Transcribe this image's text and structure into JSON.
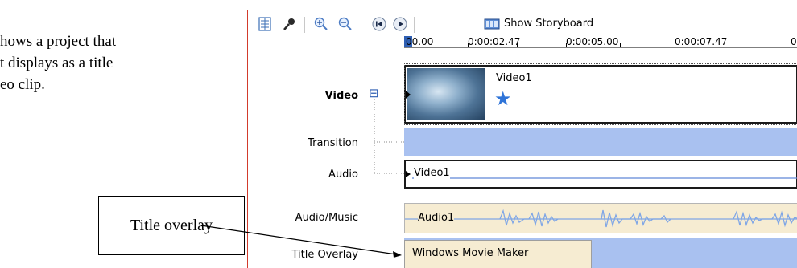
{
  "doc": {
    "line1": "hows a project that",
    "line2": "t displays as a title",
    "line3": "eo clip.",
    "callout": "Title overlay"
  },
  "toolbar": {
    "icons": [
      "timeline-icon",
      "narrate-icon",
      "zoom-in-icon",
      "zoom-out-icon",
      "rewind-icon",
      "play-icon",
      "storyboard-icon"
    ],
    "storyboard_label": "Show Storyboard"
  },
  "ruler": {
    "labels": [
      "00.00",
      "0:00:02.47",
      "0:00:05.00",
      "0:00:07.47",
      "0"
    ]
  },
  "tracks": {
    "video": "Video",
    "video_toggle": "⊟",
    "transition": "Transition",
    "audio": "Audio",
    "audio_music": "Audio/Music",
    "title_overlay": "Title Overlay"
  },
  "clips": {
    "video_clip": "Video1",
    "audio_clip": "Video1",
    "music_clip": "Audio1",
    "overlay_clip": "Windows Movie Maker"
  },
  "colors": {
    "lane_blue": "#a9c1f0",
    "music_bg": "#f6ecd2",
    "border_red": "#d23b2c"
  }
}
